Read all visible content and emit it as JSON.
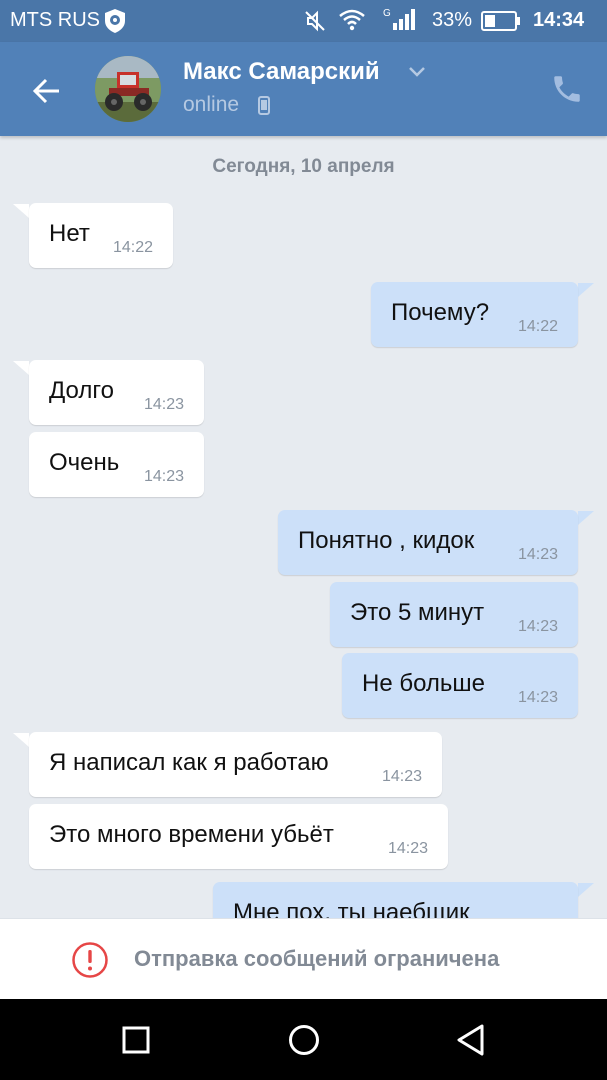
{
  "status_bar": {
    "carrier": "MTS RUS",
    "battery": "33%",
    "time": "14:34",
    "icons": [
      "carrier-logo-icon",
      "mute-icon",
      "wifi-icon",
      "signal-icon",
      "battery-icon"
    ]
  },
  "header": {
    "contact_name": "Макс Самарский",
    "status": "online",
    "icons": [
      "back-arrow-icon",
      "chevron-down-icon",
      "mobile-device-icon",
      "phone-call-icon"
    ]
  },
  "chat": {
    "date_divider": "Сегодня, 10 апреля",
    "messages": [
      {
        "direction": "in",
        "text": "Нет",
        "time": "14:22"
      },
      {
        "direction": "out",
        "text": "Почему?",
        "time": "14:22"
      },
      {
        "direction": "in",
        "text": "Долго",
        "time": "14:23"
      },
      {
        "direction": "in",
        "text": "Очень",
        "time": "14:23"
      },
      {
        "direction": "out",
        "text": "Понятно , кидок",
        "time": "14:23"
      },
      {
        "direction": "out",
        "text": "Это 5 минут",
        "time": "14:23"
      },
      {
        "direction": "out",
        "text": "Не больше",
        "time": "14:23"
      },
      {
        "direction": "in",
        "text": "Я написал как я работаю",
        "time": "14:23"
      },
      {
        "direction": "in",
        "text": "Это много времени убьёт",
        "time": "14:23"
      },
      {
        "direction": "out",
        "text": "Мне пох, ты наебщик",
        "time": ""
      }
    ]
  },
  "restriction": {
    "text": "Отправка сообщений ограничена",
    "icon": "alert-circle-icon"
  },
  "nav_bar": {
    "icons": [
      "recent-apps-icon",
      "home-icon",
      "back-icon"
    ]
  },
  "colors": {
    "header": "#5181b8",
    "status_bar": "#4a76a8",
    "background": "#e7ebf0",
    "incoming_bubble": "#ffffff",
    "outgoing_bubble": "#cce0f9",
    "alert": "#e64646"
  }
}
